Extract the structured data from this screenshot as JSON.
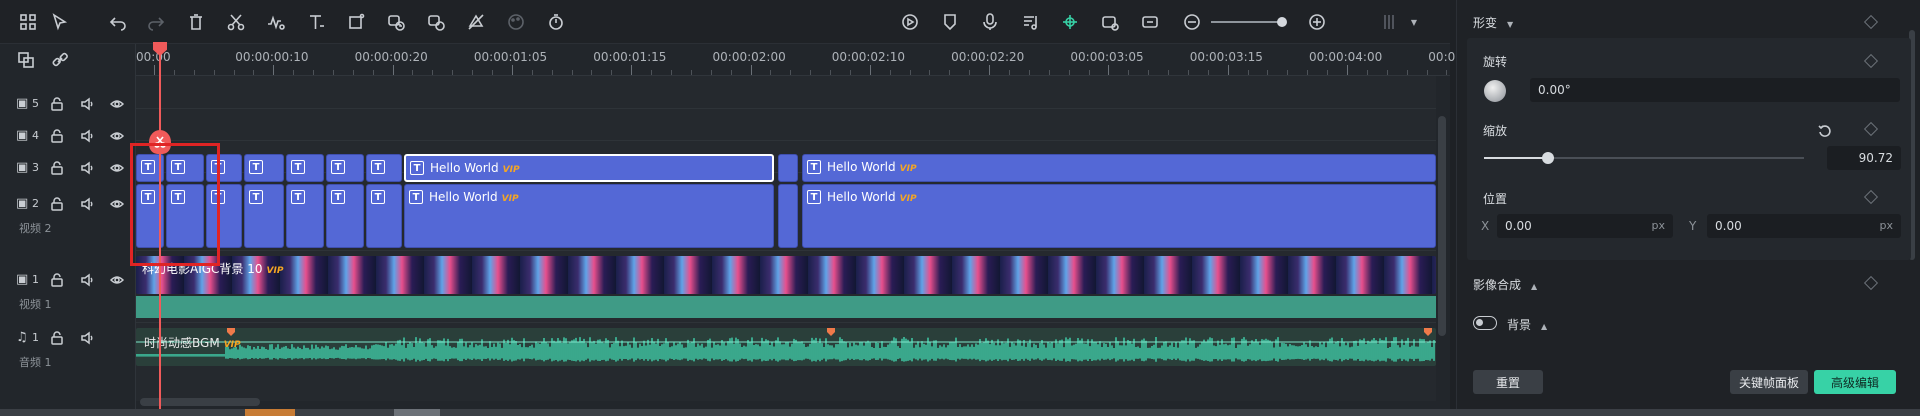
{
  "toolbar": {
    "icons": [
      "layout-icon",
      "select-arrow-icon",
      "undo-icon",
      "redo-icon",
      "delete-icon",
      "cut-icon",
      "audio-beat-icon",
      "text-icon",
      "crop-icon",
      "speed-icon",
      "color-match-icon",
      "mask-icon",
      "palette-icon",
      "timer-icon",
      "render-icon",
      "shield-icon",
      "mic-icon",
      "music-note-icon",
      "ai-split-icon",
      "snapshot-icon",
      "fit-icon",
      "zoom-out-icon",
      "zoom-in-icon",
      "grid-icon"
    ]
  },
  "ruler": {
    "labels": [
      "00:00",
      "00:00:00:10",
      "00:00:00:20",
      "00:00:01:05",
      "00:00:01:15",
      "00:00:02:00",
      "00:00:02:10",
      "00:00:02:20",
      "00:00:03:05",
      "00:00:03:15",
      "00:00:04:00",
      "00:0"
    ]
  },
  "tracks": {
    "headers": [
      {
        "num": "5",
        "name": ""
      },
      {
        "num": "4",
        "name": ""
      },
      {
        "num": "3",
        "name": ""
      },
      {
        "num": "2",
        "name": "视频 2"
      },
      {
        "num": "1",
        "name": "视频 1"
      },
      {
        "num": "1",
        "name": "音频 1"
      }
    ],
    "text_clip_icon": "T",
    "hello_label": "Hello World",
    "vip": "VIP",
    "video_clip_label": "科幻电影AIGC背景 10",
    "audio_clip_label": "时尚动感BGM"
  },
  "panel": {
    "transform_title": "形变",
    "rotate_label": "旋转",
    "rotate_value": "0.00°",
    "scale_label": "缩放",
    "scale_value": "90.72",
    "scale_level": 0.2,
    "position_label": "位置",
    "x_label": "X",
    "x_value": "0.00",
    "y_label": "Y",
    "y_value": "0.00",
    "unit": "px",
    "compositing_title": "影像合成",
    "background_label": "背景",
    "reset_button": "重置",
    "keyframe_button": "关键帧面板",
    "advanced_button": "高级编辑"
  },
  "colors": {
    "accent_green": "#37d2a6",
    "clip_blue": "#5468d6",
    "playhead_red": "#f05a5a",
    "vip_orange": "#f5a623"
  }
}
